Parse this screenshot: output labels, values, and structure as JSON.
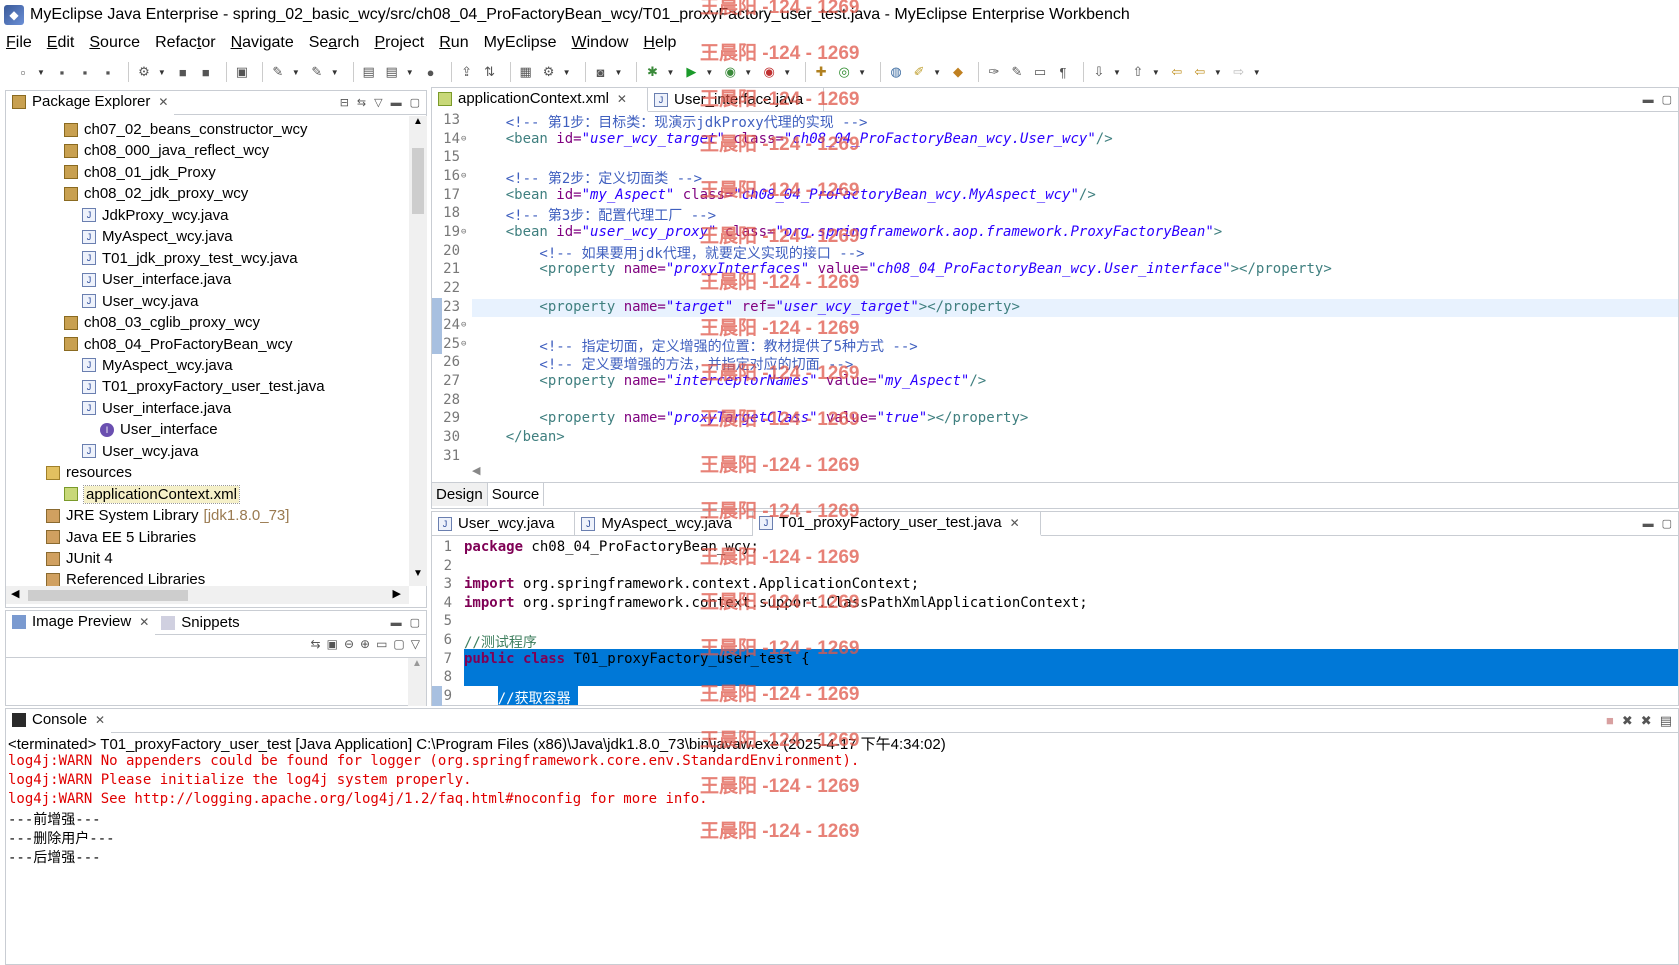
{
  "window": {
    "title": "MyEclipse Java Enterprise - spring_02_basic_wcy/src/ch08_04_ProFactoryBean_wcy/T01_proxyFactory_user_test.java - MyEclipse Enterprise Workbench"
  },
  "menu": [
    {
      "key": "F",
      "rest": "ile"
    },
    {
      "key": "E",
      "rest": "dit"
    },
    {
      "key": "S",
      "rest": "ource"
    },
    {
      "pre": "Refac",
      "key": "t",
      "rest": "or"
    },
    {
      "key": "N",
      "rest": "avigate"
    },
    {
      "pre": "Se",
      "key": "a",
      "rest": "rch"
    },
    {
      "key": "P",
      "rest": "roject"
    },
    {
      "key": "R",
      "rest": "un"
    },
    {
      "pre": "MyEclipse",
      "key": "",
      "rest": ""
    },
    {
      "key": "W",
      "rest": "indow"
    },
    {
      "key": "H",
      "rest": "elp"
    }
  ],
  "package_explorer": {
    "title": "Package Explorer",
    "items": [
      {
        "label": "ch07_02_beans_constructor_wcy",
        "icon": "package-icon",
        "indent": 1
      },
      {
        "label": "ch08_000_java_reflect_wcy",
        "icon": "package-icon",
        "indent": 1
      },
      {
        "label": "ch08_01_jdk_Proxy",
        "icon": "package-icon",
        "indent": 1
      },
      {
        "label": "ch08_02_jdk_proxy_wcy",
        "icon": "package-icon",
        "indent": 1
      },
      {
        "label": "JdkProxy_wcy.java",
        "icon": "java-file-icon",
        "indent": 2
      },
      {
        "label": "MyAspect_wcy.java",
        "icon": "java-file-icon",
        "indent": 2
      },
      {
        "label": "T01_jdk_proxy_test_wcy.java",
        "icon": "java-file-icon",
        "indent": 2
      },
      {
        "label": "User_interface.java",
        "icon": "java-file-icon",
        "indent": 2
      },
      {
        "label": "User_wcy.java",
        "icon": "java-file-icon",
        "indent": 2
      },
      {
        "label": "ch08_03_cglib_proxy_wcy",
        "icon": "package-icon",
        "indent": 1
      },
      {
        "label": "ch08_04_ProFactoryBean_wcy",
        "icon": "package-icon",
        "indent": 1
      },
      {
        "label": "MyAspect_wcy.java",
        "icon": "java-file-icon",
        "indent": 2
      },
      {
        "label": "T01_proxyFactory_user_test.java",
        "icon": "java-file-icon",
        "indent": 2
      },
      {
        "label": "User_interface.java",
        "icon": "java-file-icon",
        "indent": 2
      },
      {
        "label": "User_interface",
        "icon": "interface-icon",
        "indent": 3
      },
      {
        "label": "User_wcy.java",
        "icon": "java-file-icon",
        "indent": 2
      },
      {
        "label": "resources",
        "icon": "folder-icon",
        "indent": 0
      },
      {
        "label": "applicationContext.xml",
        "icon": "xml-file-icon",
        "indent": 1,
        "selected": true
      },
      {
        "label": "JRE System Library",
        "extra": "[jdk1.8.0_73]",
        "icon": "library-icon",
        "indent": 0
      },
      {
        "label": "Java EE 5 Libraries",
        "icon": "library-icon",
        "indent": 0
      },
      {
        "label": "JUnit 4",
        "icon": "library-icon",
        "indent": 0
      },
      {
        "label": "Referenced Libraries",
        "icon": "library-icon",
        "indent": 0
      }
    ]
  },
  "image_preview": {
    "tab1": "Image Preview",
    "tab2": "Snippets"
  },
  "xml_editor": {
    "tabs": [
      "applicationContext.xml",
      "User_interface.java"
    ],
    "bottom_tabs": [
      "Design",
      "Source"
    ],
    "lines": [
      {
        "n": "13",
        "fold": false,
        "parts": [
          [
            "cm",
            "    <!-- 第1步：目标类：现演示jdkProxy代理的实现 -->"
          ]
        ]
      },
      {
        "n": "14",
        "fold": true,
        "parts": [
          [
            "tg",
            "    <bean "
          ],
          [
            "at",
            "id="
          ],
          [
            "st",
            "\"user_wcy_target\""
          ],
          [
            "at",
            " class="
          ],
          [
            "st",
            "\"ch08_04_ProFactoryBean_wcy.User_wcy\""
          ],
          [
            "tg",
            "/>"
          ]
        ]
      },
      {
        "n": "15",
        "fold": false,
        "parts": []
      },
      {
        "n": "16",
        "fold": true,
        "parts": [
          [
            "cm",
            "    <!-- 第2步：定义切面类 -->"
          ]
        ]
      },
      {
        "n": "17",
        "fold": false,
        "parts": [
          [
            "tg",
            "    <bean "
          ],
          [
            "at",
            "id="
          ],
          [
            "st",
            "\"my_Aspect\""
          ],
          [
            "at",
            " class="
          ],
          [
            "st",
            "\"ch08_04_ProFactoryBean_wcy.MyAspect_wcy\""
          ],
          [
            "tg",
            "/>"
          ]
        ]
      },
      {
        "n": "18",
        "fold": false,
        "parts": [
          [
            "cm",
            "    <!-- 第3步：配置代理工厂 -->"
          ]
        ]
      },
      {
        "n": "19",
        "fold": true,
        "parts": [
          [
            "tg",
            "    <bean "
          ],
          [
            "at",
            "id="
          ],
          [
            "st",
            "\"user_wcy_proxy\""
          ],
          [
            "at",
            " class="
          ],
          [
            "st",
            "\"org.springframework.aop.framework.ProxyFactoryBean\""
          ],
          [
            "tg",
            ">"
          ]
        ]
      },
      {
        "n": "20",
        "fold": false,
        "parts": [
          [
            "cm",
            "        <!-- 如果要用jdk代理，就要定义实现的接口 -->"
          ]
        ]
      },
      {
        "n": "21",
        "fold": false,
        "parts": [
          [
            "tg",
            "        <property "
          ],
          [
            "at",
            "name="
          ],
          [
            "st",
            "\"proxyInterfaces\""
          ],
          [
            "at",
            " value="
          ],
          [
            "st",
            "\"ch08_04_ProFactoryBean_wcy.User_interface\""
          ],
          [
            "tg",
            "></property>"
          ]
        ]
      },
      {
        "n": "22",
        "fold": false,
        "parts": []
      },
      {
        "n": "23",
        "fold": false,
        "current": true,
        "parts": [
          [
            "tg",
            "        <property "
          ],
          [
            "at",
            "name="
          ],
          [
            "st",
            "\"target\""
          ],
          [
            "at",
            " ref="
          ],
          [
            "st",
            "\"user_wcy_target\""
          ],
          [
            "tg",
            "></property>"
          ]
        ]
      },
      {
        "n": "24",
        "fold": true,
        "parts": []
      },
      {
        "n": "25",
        "fold": true,
        "parts": [
          [
            "cm",
            "        <!-- 指定切面，定义增强的位置：教材提供了5种方式 -->"
          ]
        ]
      },
      {
        "n": "26",
        "fold": false,
        "parts": [
          [
            "cm",
            "        <!-- 定义要增强的方法，并指定对应的切面 -->"
          ]
        ]
      },
      {
        "n": "27",
        "fold": false,
        "parts": [
          [
            "tg",
            "        <property "
          ],
          [
            "at",
            "name="
          ],
          [
            "st",
            "\"interceptorNames\""
          ],
          [
            "at",
            " value="
          ],
          [
            "st",
            "\"my_Aspect\""
          ],
          [
            "tg",
            "/>"
          ]
        ]
      },
      {
        "n": "28",
        "fold": false,
        "parts": []
      },
      {
        "n": "29",
        "fold": false,
        "parts": [
          [
            "tg",
            "        <property "
          ],
          [
            "at",
            "name="
          ],
          [
            "st",
            "\"proxyTargetClass\""
          ],
          [
            "at",
            " value="
          ],
          [
            "st",
            "\"true\""
          ],
          [
            "tg",
            "></property>"
          ]
        ]
      },
      {
        "n": "30",
        "fold": false,
        "parts": [
          [
            "tg",
            "    </bean>"
          ]
        ]
      },
      {
        "n": "31",
        "fold": false,
        "parts": []
      }
    ]
  },
  "java_editor": {
    "tabs": [
      "User_wcy.java",
      "MyAspect_wcy.java",
      "T01_proxyFactory_user_test.java"
    ],
    "lines": [
      {
        "n": "1",
        "parts": [
          [
            "kw",
            "package"
          ],
          [
            "",
            "ch08_04_ProFactoryBean_wcy;"
          ]
        ]
      },
      {
        "n": "2",
        "parts": []
      },
      {
        "n": "3",
        "parts": [
          [
            "kw",
            "import"
          ],
          [
            "",
            "org.springframework.context.ApplicationContext;"
          ]
        ]
      },
      {
        "n": "4",
        "parts": [
          [
            "kw",
            "import"
          ],
          [
            "",
            "org.springframework.context.support.ClassPathXmlApplicationContext;"
          ]
        ]
      },
      {
        "n": "5",
        "parts": []
      },
      {
        "n": "6",
        "parts": [
          [
            "jc",
            "//测试程序"
          ]
        ]
      },
      {
        "n": "7",
        "parts": [
          [
            "kw",
            "public"
          ],
          [
            "kw",
            "class"
          ],
          [
            "",
            "T01_proxyFactory_user_test {"
          ]
        ]
      },
      {
        "n": "8",
        "parts": []
      },
      {
        "n": "9",
        "parts": [
          [
            "jc",
            "    //获取容器"
          ]
        ]
      }
    ]
  },
  "console": {
    "title": "Console",
    "header": "<terminated> T01_proxyFactory_user_test [Java Application] C:\\Program Files (x86)\\Java\\jdk1.8.0_73\\bin\\javaw.exe (2025-4-17 下午4:34:02)",
    "lines": [
      {
        "text": "log4j:WARN No appenders could be found for logger (org.springframework.core.env.StandardEnvironment).",
        "err": true
      },
      {
        "text": "log4j:WARN Please initialize the log4j system properly.",
        "err": true
      },
      {
        "text": "log4j:WARN See http://logging.apache.org/log4j/1.2/faq.html#noconfig for more info.",
        "err": true
      },
      {
        "text": "---前增强---",
        "err": false
      },
      {
        "text": "---删除用户---",
        "err": false
      },
      {
        "text": "---后增强---",
        "err": false
      }
    ]
  },
  "watermark": "王晨阳 -124 - 1269"
}
